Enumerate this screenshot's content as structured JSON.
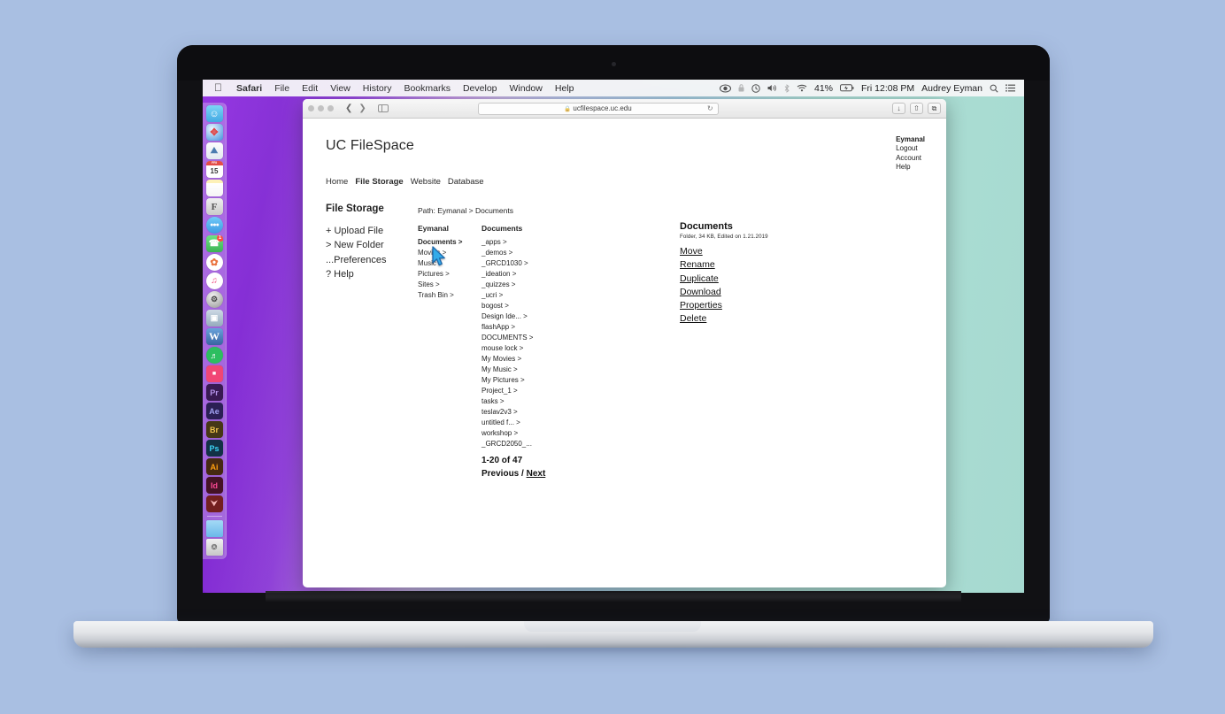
{
  "desktop": {
    "menu_bar": {
      "apple_icon": "apple-icon",
      "items": [
        {
          "label": "Safari",
          "bold": true
        },
        {
          "label": "File",
          "bold": false
        },
        {
          "label": "Edit",
          "bold": false
        },
        {
          "label": "View",
          "bold": false
        },
        {
          "label": "History",
          "bold": false
        },
        {
          "label": "Bookmarks",
          "bold": false
        },
        {
          "label": "Develop",
          "bold": false
        },
        {
          "label": "Window",
          "bold": false
        },
        {
          "label": "Help",
          "bold": false
        }
      ],
      "status": {
        "battery_percent": "41%",
        "datetime": "Fri 12:08 PM",
        "user": "Audrey Eyman",
        "icons": [
          "accessibility-icon",
          "lock-icon",
          "time-machine-icon",
          "volume-icon",
          "bluetooth-icon",
          "wifi-icon",
          "battery-icon",
          "search-icon",
          "control-center-icon"
        ]
      }
    },
    "dock": {
      "items": [
        {
          "name": "finder",
          "label": "",
          "bg": "#3da8e8",
          "glyph": "☺"
        },
        {
          "name": "safari",
          "label": "",
          "bg": "#2d8fe0",
          "glyph": "✦"
        },
        {
          "name": "preview",
          "label": "",
          "bg": "#f2f2f2",
          "glyph": "⛰"
        },
        {
          "name": "calendar",
          "label": "15",
          "bg": "#ffffff",
          "glyph": ""
        },
        {
          "name": "notes",
          "label": "",
          "bg": "#fdf3c8",
          "glyph": ""
        },
        {
          "name": "font-book",
          "label": "F",
          "bg": "#d8d8d8",
          "glyph": ""
        },
        {
          "name": "messages",
          "label": "",
          "bg": "#4fb2f0",
          "glyph": "●"
        },
        {
          "name": "facetime",
          "label": "",
          "bg": "#3ec95b",
          "glyph": "☎",
          "badge": "1"
        },
        {
          "name": "photos",
          "label": "",
          "bg": "#ffffff",
          "glyph": "✿"
        },
        {
          "name": "itunes",
          "label": "",
          "bg": "#f04a7e",
          "glyph": "♪"
        },
        {
          "name": "app-store",
          "label": "",
          "bg": "#4a4a4a",
          "glyph": "A"
        },
        {
          "name": "image-capture",
          "label": "",
          "bg": "#8fa5b8",
          "glyph": "▣"
        },
        {
          "name": "microsoft-word",
          "label": "W",
          "bg": "#2b579a",
          "glyph": ""
        },
        {
          "name": "spotify",
          "label": "",
          "bg": "#1db954",
          "glyph": "♬"
        },
        {
          "name": "unknown-pink-app",
          "label": "",
          "bg": "#f0396b",
          "glyph": "■"
        },
        {
          "name": "adobe-premiere",
          "label": "Pr",
          "bg": "#2a0a45",
          "fg": "#b08ce8"
        },
        {
          "name": "adobe-after-effects",
          "label": "Ae",
          "bg": "#1c1048",
          "fg": "#9b9bf0"
        },
        {
          "name": "adobe-bridge",
          "label": "Br",
          "bg": "#3a2a05",
          "fg": "#f0c040"
        },
        {
          "name": "adobe-photoshop",
          "label": "Ps",
          "bg": "#03243a",
          "fg": "#2fd0f5"
        },
        {
          "name": "adobe-illustrator",
          "label": "Ai",
          "bg": "#3a1c02",
          "fg": "#ff9a00"
        },
        {
          "name": "adobe-indesign",
          "label": "Id",
          "bg": "#3a0418",
          "fg": "#ff3f8f"
        },
        {
          "name": "adobe-acrobat",
          "label": "",
          "bg": "#6b1212",
          "glyph": "⮟"
        },
        {
          "name": "downloads-folder",
          "label": "",
          "bg": "#7dc8f0",
          "glyph": ""
        },
        {
          "name": "trash",
          "label": "",
          "bg": "#dcdcdc",
          "glyph": "⌧"
        }
      ]
    }
  },
  "browser": {
    "traffic_lights": [
      "close-button",
      "minimize-button",
      "maximize-button"
    ],
    "back_icon": "chevron-left-icon",
    "forward_icon": "chevron-right-icon",
    "sidebar_icon": "sidebar-toggle-icon",
    "url": "ucfilespace.uc.edu",
    "lock_icon": "lock-icon",
    "reload_icon": "reload-icon",
    "toolbar_buttons": [
      {
        "name": "downloads-button",
        "glyph": "↓"
      },
      {
        "name": "share-button",
        "glyph": "⇧"
      },
      {
        "name": "tabs-button",
        "glyph": "⧉"
      }
    ]
  },
  "page": {
    "title": "UC FileSpace",
    "nav": [
      {
        "label": "Home",
        "active": false
      },
      {
        "label": "File Storage",
        "active": true
      },
      {
        "label": "Website",
        "active": false
      },
      {
        "label": "Database",
        "active": false
      }
    ],
    "account": {
      "user": "Eymanal",
      "links": [
        "Logout",
        "Account",
        "Help"
      ]
    },
    "sidebar": {
      "heading": "File Storage",
      "actions": [
        "+ Upload File",
        "> New Folder",
        "...Preferences",
        "? Help"
      ]
    },
    "path": "Path: Eymanal > Documents",
    "columns": [
      {
        "header": "Eymanal",
        "items": [
          {
            "label": "Documents >",
            "selected": true
          },
          {
            "label": "Movies >",
            "selected": false
          },
          {
            "label": "Music >",
            "selected": false
          },
          {
            "label": "Pictures >",
            "selected": false
          },
          {
            "label": "Sites >",
            "selected": false
          },
          {
            "label": "Trash Bin >",
            "selected": false
          }
        ]
      },
      {
        "header": "Documents",
        "items": [
          {
            "label": "_apps >",
            "selected": false
          },
          {
            "label": "_demos >",
            "selected": false
          },
          {
            "label": "_GRCD1030 >",
            "selected": false
          },
          {
            "label": "_ideation >",
            "selected": false
          },
          {
            "label": "_quizzes >",
            "selected": false
          },
          {
            "label": "_ucri >",
            "selected": false
          },
          {
            "label": "bogost >",
            "selected": false
          },
          {
            "label": "Design Ide... >",
            "selected": false
          },
          {
            "label": "flashApp >",
            "selected": false
          },
          {
            "label": "DOCUMENTS >",
            "selected": false
          },
          {
            "label": "mouse lock >",
            "selected": false
          },
          {
            "label": "My Movies >",
            "selected": false
          },
          {
            "label": "My Music >",
            "selected": false
          },
          {
            "label": "My Pictures >",
            "selected": false
          },
          {
            "label": "Project_1 >",
            "selected": false
          },
          {
            "label": "tasks >",
            "selected": false
          },
          {
            "label": "teslav2v3 >",
            "selected": false
          },
          {
            "label": "untitled f... >",
            "selected": false
          },
          {
            "label": "workshop >",
            "selected": false
          },
          {
            "label": "_GRCD2050_...",
            "selected": false
          }
        ]
      }
    ],
    "pagination": {
      "range": "1-20 of 47",
      "previous_label": "Previous",
      "separator": " / ",
      "next_label": "Next"
    },
    "detail": {
      "title": "Documents",
      "meta": "Folder, 34 KB, Edited on 1.21.2019",
      "actions": [
        "Move",
        "Rename",
        "Duplicate",
        "Download",
        "Properties",
        "Delete"
      ]
    }
  },
  "cursor": {
    "name": "mouse-pointer",
    "fill": "#2aa8e8",
    "stroke": "#1462a8"
  }
}
